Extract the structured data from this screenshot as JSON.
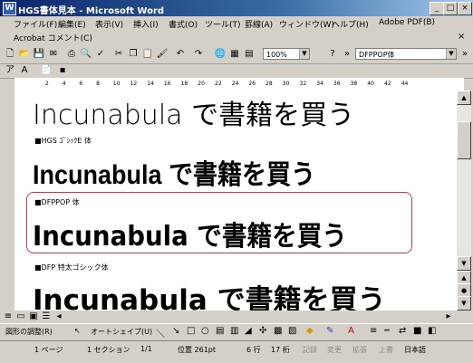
{
  "window": {
    "title": "HGS書体見本 - Microsoft Word"
  },
  "menu": [
    "ファイル(F)",
    "編集(E)",
    "表示(V)",
    "挿入(I)",
    "書式(O)",
    "ツール(T)",
    "罫線(A)",
    "ウィンドウ(W)",
    "ヘルプ(H)",
    "Adobe PDF(B)"
  ],
  "menu2": "Acrobat コメント(C)",
  "toolbar": {
    "zoom": "100%",
    "font": "DFPPOP体"
  },
  "ruler_ticks": [
    "2",
    "4",
    "6",
    "8",
    "10",
    "12",
    "14",
    "16",
    "18",
    "20",
    "22",
    "24",
    "26",
    "28",
    "30",
    "32",
    "34",
    "36",
    "38",
    "40",
    "42",
    "44"
  ],
  "document": {
    "sample_text": "Incunabula で書籍を買う",
    "labels": [
      "■HGS ｺﾞｼｯｸE 体",
      "■DFPPOP 体",
      "■DFP 特太ゴシック体"
    ]
  },
  "drawbar": {
    "adjust": "図形の調整(R)",
    "autoshape": "オートシェイプ(U)"
  },
  "status": {
    "page": "1 ページ",
    "section": "1 セクション",
    "pages": "1/1",
    "position": "位置 261pt",
    "line": "6 行",
    "column": "17 桁",
    "rec": "記録",
    "trk": "変更",
    "ext": "拡張",
    "ovr": "上書",
    "lang": "日本語"
  }
}
